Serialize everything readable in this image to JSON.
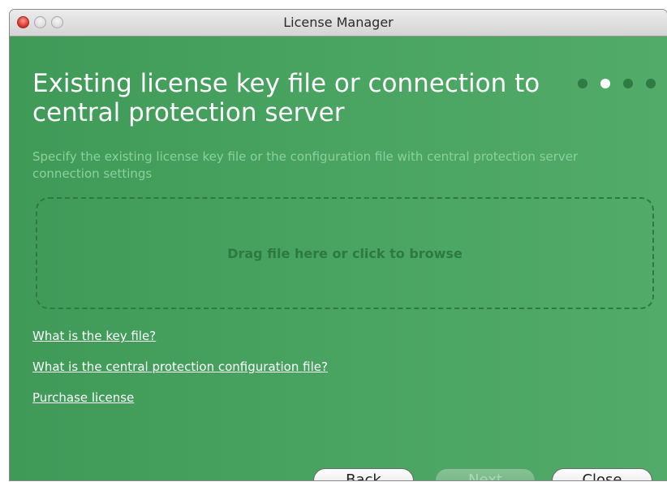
{
  "window": {
    "title": "License Manager"
  },
  "heading": "Existing license key file or connection to central protection server",
  "description": "Specify the existing license key file or the configuration file with central protection server connection settings",
  "steps": {
    "total": 4,
    "current": 2
  },
  "dropzone": {
    "label": "Drag file here or click to browse"
  },
  "links": {
    "key_file": "What is the key file?",
    "config_file": "What is the central protection configuration file?",
    "purchase": "Purchase license"
  },
  "buttons": {
    "back": "Back",
    "next": "Next",
    "close": "Close"
  },
  "colors": {
    "background": "#4aa462",
    "accent_dark": "#2e7c43",
    "description_text": "#8bd09e"
  }
}
